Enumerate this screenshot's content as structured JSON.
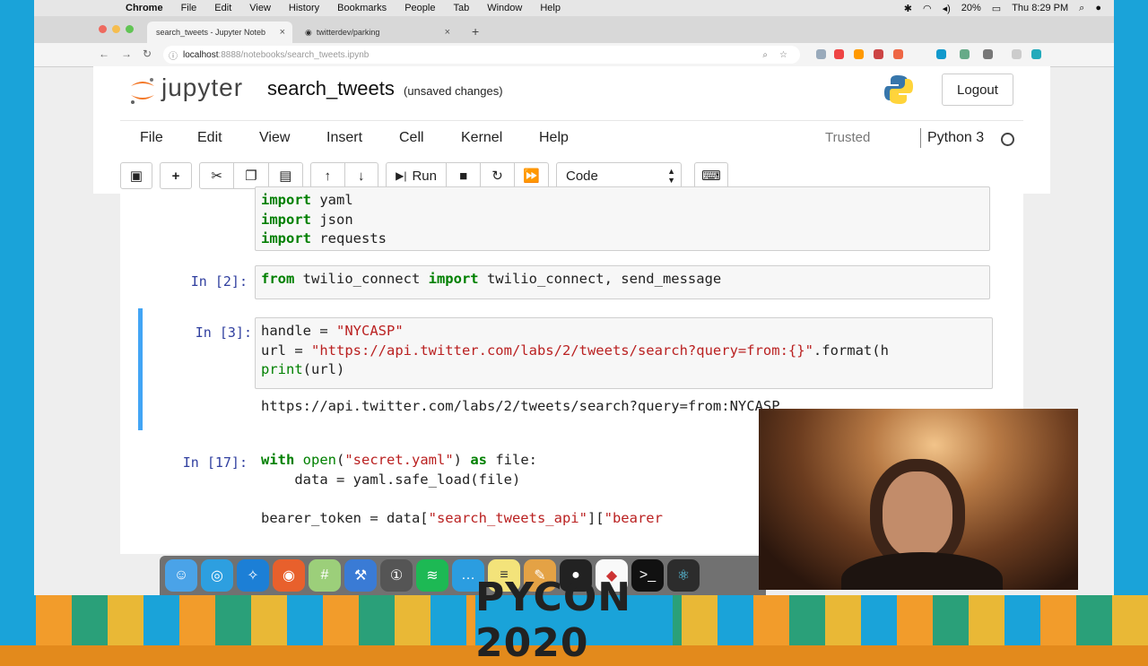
{
  "menubar": {
    "app": "Chrome",
    "items": [
      "File",
      "Edit",
      "View",
      "History",
      "Bookmarks",
      "People",
      "Tab",
      "Window",
      "Help"
    ],
    "battery": "20%",
    "clock": "Thu 8:29 PM"
  },
  "browser": {
    "tabs": [
      {
        "title": "search_tweets - Jupyter Noteb"
      },
      {
        "title": "twitterdev/parking"
      }
    ],
    "url_host": "localhost",
    "url_path": ":8888/notebooks/search_tweets.ipynb"
  },
  "jupyter": {
    "logo_text": "jupyter",
    "notebook_name": "search_tweets",
    "save_status": "(unsaved changes)",
    "logout_label": "Logout",
    "menu": [
      "File",
      "Edit",
      "View",
      "Insert",
      "Cell",
      "Kernel",
      "Help"
    ],
    "trusted": "Trusted",
    "kernel": "Python 3",
    "toolbar": {
      "run_label": "Run",
      "cell_type": "Code"
    }
  },
  "cells": [
    {
      "prompt": "",
      "lines": [
        "import yaml",
        "import json",
        "import requests"
      ]
    },
    {
      "prompt": "In [2]:",
      "lines": [
        "from twilio_connect import twilio_connect, send_message"
      ]
    },
    {
      "prompt": "In [3]:",
      "lines": [
        "handle = \"NYCASP\"",
        "url = \"https://api.twitter.com/labs/2/tweets/search?query=from:{}\".format(h",
        "print(url)"
      ],
      "output": "https://api.twitter.com/labs/2/tweets/search?query=from:NYCASP"
    },
    {
      "prompt": "In [17]:",
      "lines": [
        "with open(\"secret.yaml\") as file:",
        "    data = yaml.safe_load(file)",
        "",
        "bearer_token = data[\"search_tweets_api\"][\"bearer"
      ]
    }
  ],
  "banner": {
    "text": "PYCON 2020"
  },
  "colors": {
    "accent": "#42a5f5",
    "prompt": "#303f9f",
    "keyword": "#008000",
    "string": "#ba2121"
  }
}
